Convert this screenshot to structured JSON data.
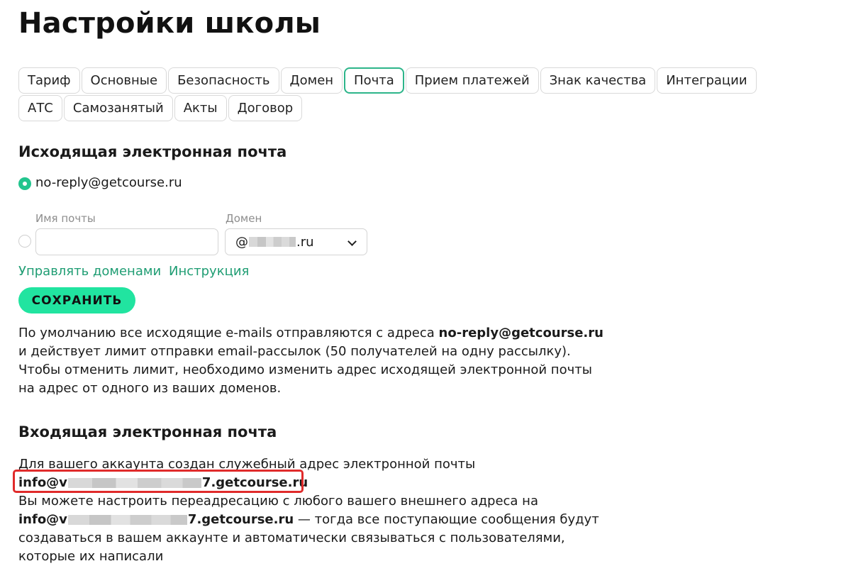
{
  "page": {
    "title": "Настройки школы"
  },
  "tabs": {
    "row1": [
      {
        "label": "Тариф",
        "active": false
      },
      {
        "label": "Основные",
        "active": false
      },
      {
        "label": "Безопасность",
        "active": false
      },
      {
        "label": "Домен",
        "active": false
      },
      {
        "label": "Почта",
        "active": true
      },
      {
        "label": "Прием платежей",
        "active": false
      },
      {
        "label": "Знак качества",
        "active": false
      },
      {
        "label": "Интеграции",
        "active": false
      }
    ],
    "row2": [
      {
        "label": "АТС",
        "active": false
      },
      {
        "label": "Самозанятый",
        "active": false
      },
      {
        "label": "Акты",
        "active": false
      },
      {
        "label": "Договор",
        "active": false
      }
    ]
  },
  "outgoing": {
    "title": "Исходящая электронная почта",
    "default_option": "no-reply@getcourse.ru",
    "mail_name_label": "Имя почты",
    "mail_name_value": "",
    "domain_label": "Домен",
    "domain_prefix": "@",
    "domain_suffix": ".ru",
    "manage_domains_link": "Управлять доменами",
    "instruction_link": "Инструкция",
    "save_label": "СОХРАНИТЬ",
    "description": {
      "line1_text": "По умолчанию все исходящие e-mails отправляются с адреса ",
      "line1_bold": "no-reply@getcourse.ru",
      "line2": "и действует лимит отправки email-рассылок (50 получателей на одну рассылку).",
      "line3": "Чтобы отменить лимит, необходимо изменить адрес исходящей электронной почты",
      "line4": "на адрес от одного из ваших доменов."
    }
  },
  "incoming": {
    "title": "Входящая электронная почта",
    "line1": "Для вашего аккаунта создан служебный адрес электронной почты",
    "address_prefix": "info@v",
    "address_suffix": "7.getcourse.ru",
    "line3": "Вы можете настроить переадресацию с любого вашего внешнего адреса на",
    "line4_prefix": "info@v",
    "line4_suffix": "7.getcourse.ru",
    "line4_rest": " — тогда все поступающие сообщения будут",
    "line5": "создаваться в вашем аккаунте и автоматически связываться с пользователями,",
    "line6": "которые их написали"
  },
  "colors": {
    "accent": "#22c58e",
    "link": "#1f9d73",
    "save_button": "#21e4a0",
    "highlight": "#e02b2b"
  }
}
